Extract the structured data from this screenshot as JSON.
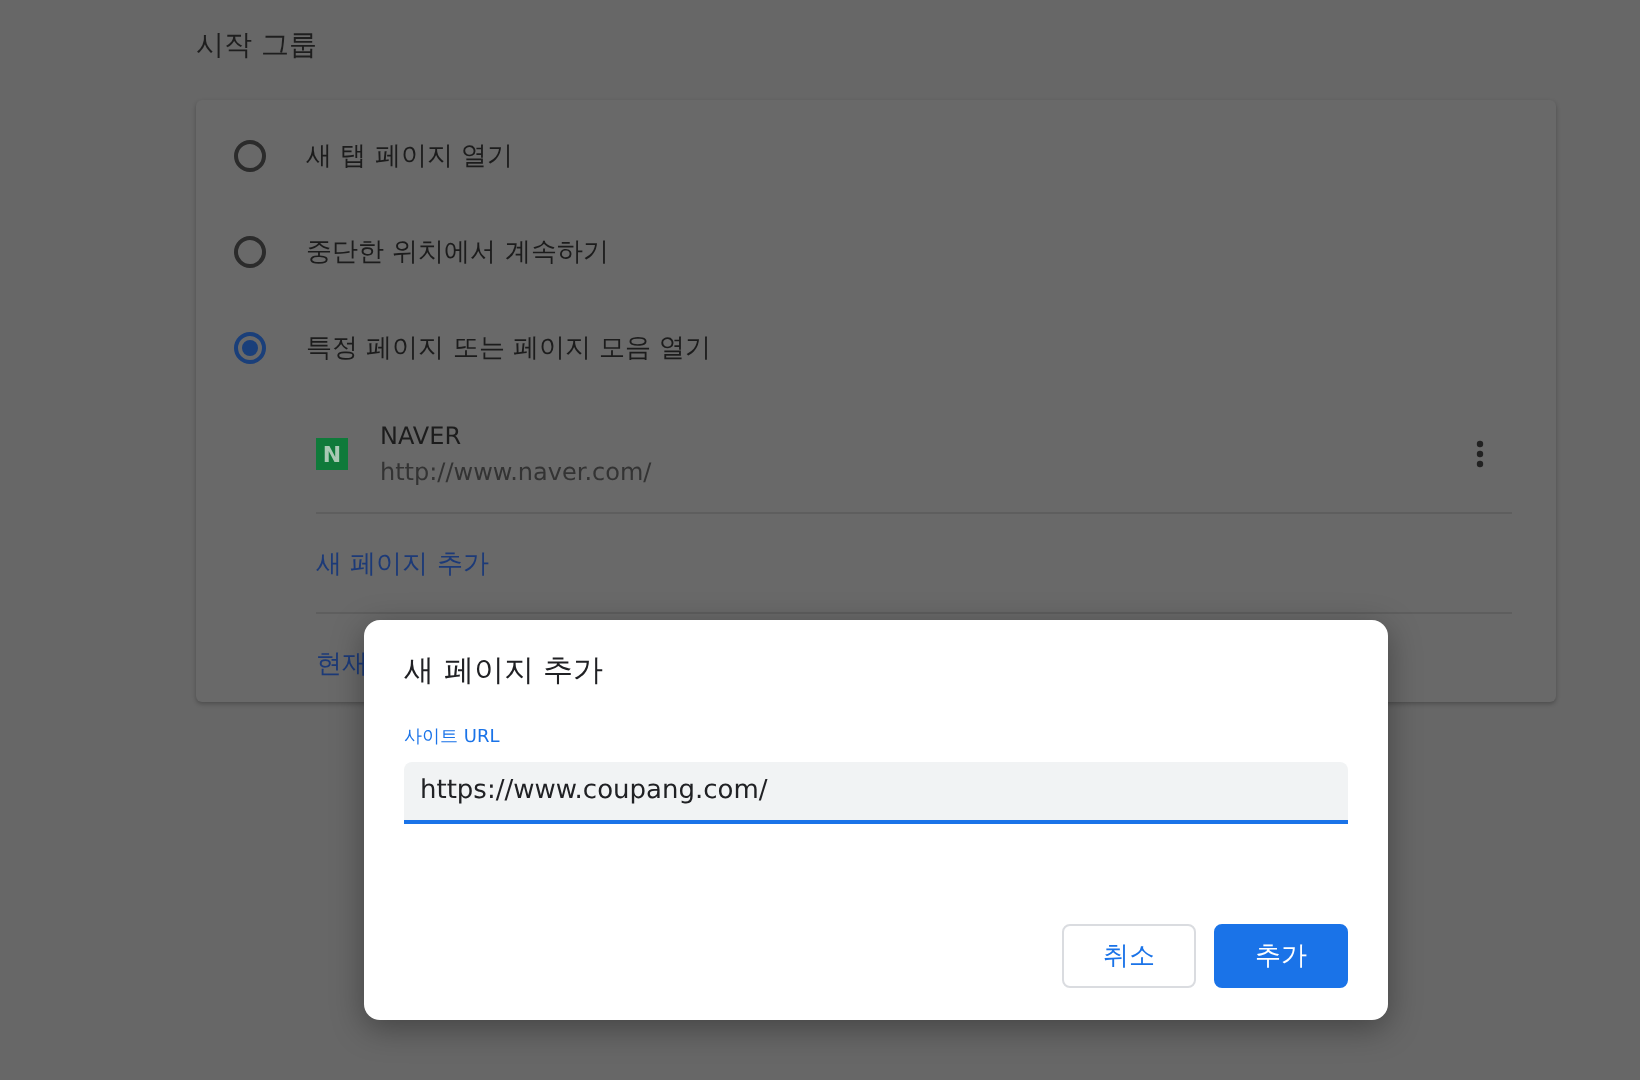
{
  "section_title": "시작 그룹",
  "startup_options": [
    {
      "label": "새 탭 페이지 열기",
      "selected": false
    },
    {
      "label": "중단한 위치에서 계속하기",
      "selected": false
    },
    {
      "label": "특정 페이지 또는 페이지 모음 열기",
      "selected": true
    }
  ],
  "pages": [
    {
      "name": "NAVER",
      "url": "http://www.naver.com/",
      "favicon": "N"
    }
  ],
  "add_page_link": "새 페이지 추가",
  "current_pages_link": "현재",
  "dialog": {
    "title": "새 페이지 추가",
    "field_label": "사이트 URL",
    "field_value": "https://www.coupang.com/",
    "buttons": [
      {
        "label": "취소",
        "kind": "secondary"
      },
      {
        "label": "추가",
        "kind": "primary"
      }
    ]
  }
}
